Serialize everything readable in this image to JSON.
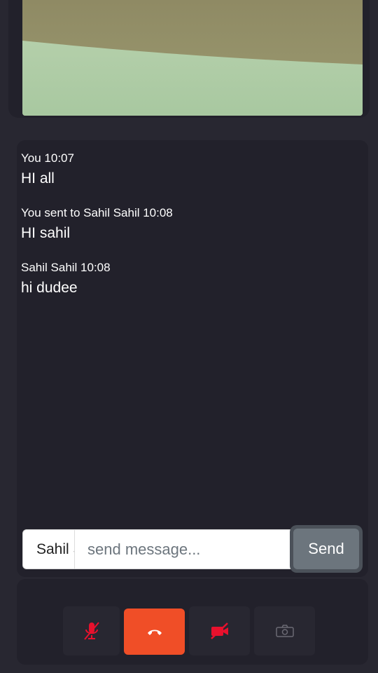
{
  "chat": {
    "messages": [
      {
        "meta": "You 10:07",
        "text": "HI all"
      },
      {
        "meta": "You sent to Sahil Sahil 10:08",
        "text": "HI sahil"
      },
      {
        "meta": "Sahil Sahil 10:08",
        "text": "hi dudee"
      }
    ]
  },
  "composer": {
    "recipient": "Sahil Sahil",
    "placeholder": "send message...",
    "send_label": "Send"
  },
  "controls": {
    "mic_icon": "mic-muted-icon",
    "end_call_icon": "phone-hangup-icon",
    "camera_icon": "video-off-icon",
    "screenshot_icon": "camera-icon"
  },
  "colors": {
    "background": "#282731",
    "panel": "#22212b",
    "end_call": "#f04e27",
    "muted_icon": "#e8112d",
    "send_button": "#6c757d"
  }
}
